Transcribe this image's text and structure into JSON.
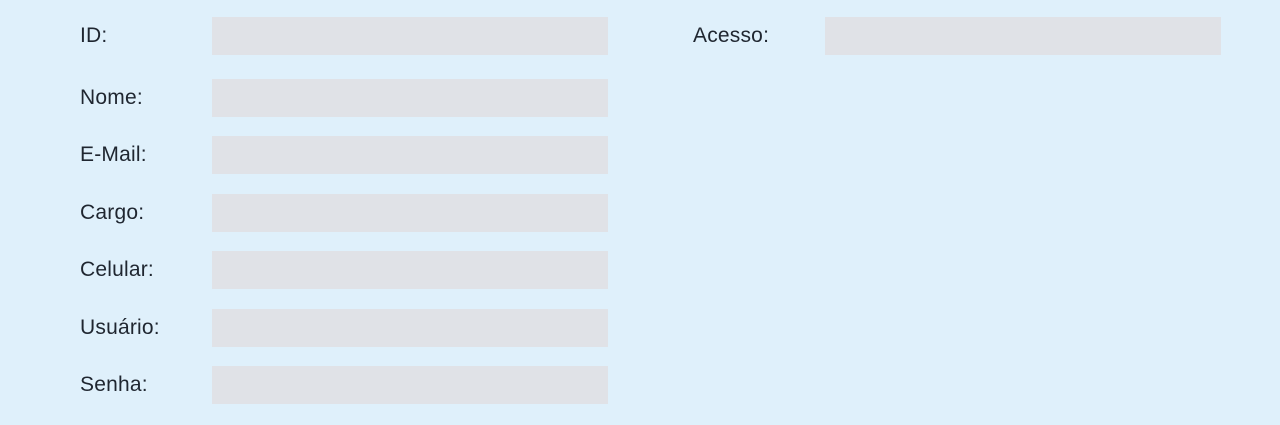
{
  "form": {
    "fields": {
      "id": {
        "label": "ID:",
        "value": ""
      },
      "nome": {
        "label": "Nome:",
        "value": ""
      },
      "email": {
        "label": "E-Mail:",
        "value": ""
      },
      "cargo": {
        "label": "Cargo:",
        "value": ""
      },
      "celular": {
        "label": "Celular:",
        "value": ""
      },
      "usuario": {
        "label": "Usuário:",
        "value": ""
      },
      "senha": {
        "label": "Senha:",
        "value": ""
      },
      "acesso": {
        "label": "Acesso:",
        "value": ""
      }
    }
  },
  "colors": {
    "background": "#dff0fb",
    "input_fill": "#e0e2e7",
    "text": "#1f2630"
  }
}
